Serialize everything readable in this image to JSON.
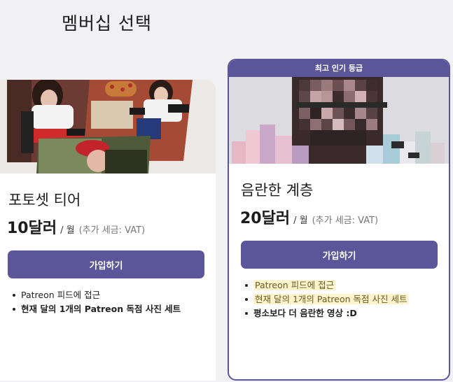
{
  "page": {
    "title": "멤버십 선택"
  },
  "tiers": [
    {
      "name": "포토셋 티어",
      "price": "10달러",
      "per": "/ 월",
      "vat": "(추가 세금: VAT)",
      "join_label": "가입하기",
      "benefits": [
        "Patreon 피드에 접근",
        "현재 달의 1개의 Patreon 독점 사진 세트"
      ]
    },
    {
      "banner": "최고 인기 등급",
      "name": "음란한 계층",
      "price": "20달러",
      "per": "/ 월",
      "vat": "(추가 세금: VAT)",
      "join_label": "가입하기",
      "benefits": [
        "Patreon 피드에 접근",
        "현재 달의 1개의 Patreon 독점 사진 세트",
        "평소보다 더 음란한 영상 :D"
      ]
    }
  ],
  "colors": {
    "accent": "#5b5599",
    "page_bg": "#f1f1f3",
    "highlight": "#fdf3cf"
  }
}
